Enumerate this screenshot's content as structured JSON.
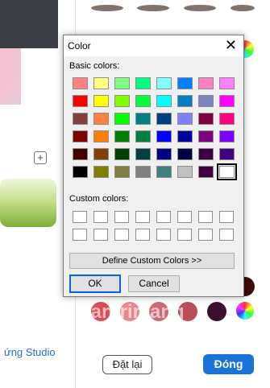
{
  "background": {
    "studio_link": "ứng Studio",
    "reset_button": "Đặt lại",
    "close_button": "Đóng",
    "watermark": "uantrimang",
    "bottom_swatches": [
      "#d94b55",
      "#e8878a",
      "#c96b74",
      "#b84e5a",
      "#3d0f2e"
    ],
    "dark_swatch": "#3e0b0b"
  },
  "dialog": {
    "title": "Color",
    "basic_colors_label": "Basic colors:",
    "custom_colors_label": "Custom colors:",
    "define_custom_button": "Define Custom Colors >>",
    "ok_button": "OK",
    "cancel_button": "Cancel",
    "basic_colors": [
      [
        "#ff8080",
        "#ffff80",
        "#80ff80",
        "#00ff80",
        "#80ffff",
        "#0080ff",
        "#ff80c0",
        "#ff80ff"
      ],
      [
        "#ff0000",
        "#ffff00",
        "#80ff00",
        "#00ff40",
        "#00ffff",
        "#0080c0",
        "#8080c0",
        "#ff00ff"
      ],
      [
        "#804040",
        "#ff8040",
        "#00ff00",
        "#008080",
        "#004080",
        "#8080ff",
        "#800040",
        "#ff0080"
      ],
      [
        "#800000",
        "#ff8000",
        "#008000",
        "#008040",
        "#0000ff",
        "#0000a0",
        "#800080",
        "#8000ff"
      ],
      [
        "#400000",
        "#804000",
        "#004000",
        "#004040",
        "#000080",
        "#000040",
        "#400040",
        "#400080"
      ],
      [
        "#000000",
        "#808000",
        "#808040",
        "#808080",
        "#408080",
        "#c0c0c0",
        "#400040",
        "#ffffff"
      ]
    ],
    "selected_color": "#ffffff"
  }
}
